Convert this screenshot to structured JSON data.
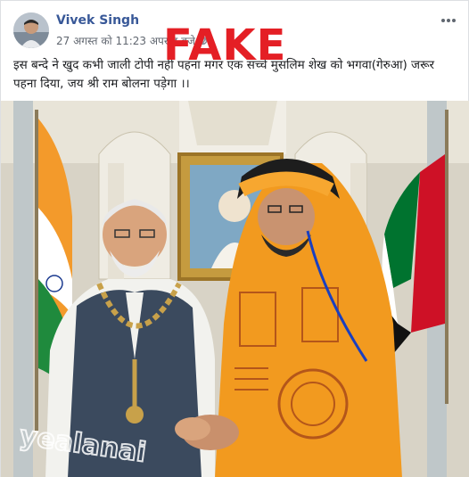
{
  "post": {
    "author_name": "Vivek Singh",
    "timestamp": "27 अगस्त को 11:23 अपराह्न बजे",
    "privacy_icon": "globe-icon",
    "more_icon": "more-options-icon",
    "text": "इस बन्दे ने खुद कभी जाली टोपी नहीं पहना मगर एक सच्चे मुसलिम शेख को भगवा(गेरुआ) जरूर पहना दिया, जय श्री राम बोलना पड़ेगा ।।",
    "stamp_label": "FAKE",
    "photo_watermark": "yealanai"
  },
  "colors": {
    "author_link": "#385898",
    "meta_text": "#616770",
    "stamp_red": "#e41f25",
    "saffron": "#f29a1f",
    "annotation_line": "#1a3fbf"
  }
}
